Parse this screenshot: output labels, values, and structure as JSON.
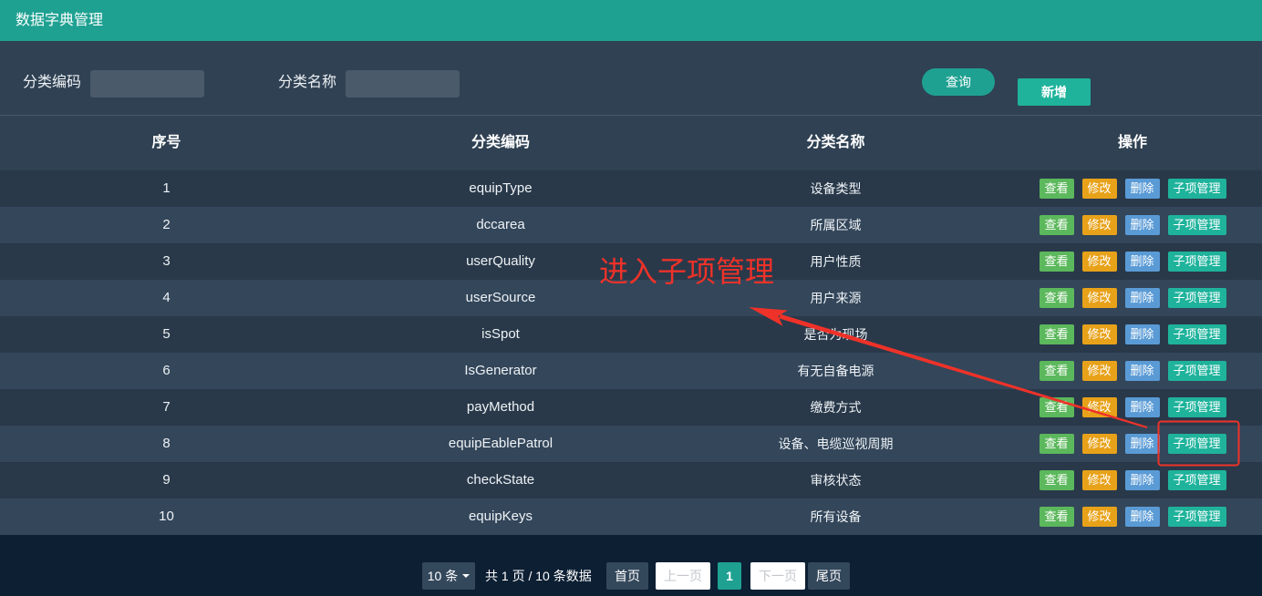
{
  "header": {
    "title": "数据字典管理"
  },
  "search": {
    "code_label": "分类编码",
    "code_value": "",
    "name_label": "分类名称",
    "name_value": "",
    "query_button": "查询",
    "add_button": "新增"
  },
  "table": {
    "columns": {
      "index": "序号",
      "code": "分类编码",
      "name": "分类名称",
      "actions": "操作"
    },
    "rows": [
      {
        "index": "1",
        "code": "equipType",
        "name": "设备类型"
      },
      {
        "index": "2",
        "code": "dccarea",
        "name": "所属区域"
      },
      {
        "index": "3",
        "code": "userQuality",
        "name": "用户性质"
      },
      {
        "index": "4",
        "code": "userSource",
        "name": "用户来源"
      },
      {
        "index": "5",
        "code": "isSpot",
        "name": "是否为现场"
      },
      {
        "index": "6",
        "code": "IsGenerator",
        "name": "有无自备电源"
      },
      {
        "index": "7",
        "code": "payMethod",
        "name": "缴费方式"
      },
      {
        "index": "8",
        "code": "equipEablePatrol",
        "name": "设备、电缆巡视周期"
      },
      {
        "index": "9",
        "code": "checkState",
        "name": "审核状态"
      },
      {
        "index": "10",
        "code": "equipKeys",
        "name": "所有设备"
      }
    ],
    "row_actions": {
      "view": "查看",
      "edit": "修改",
      "delete": "删除",
      "sub_items": "子项管理"
    }
  },
  "pagination": {
    "page_size": "10 条",
    "page_size_icon": "caret-down-icon",
    "summary": "共 1 页 / 10 条数据",
    "first": "首页",
    "prev": "上一页",
    "current_page": "1",
    "next": "下一页",
    "last": "尾页"
  },
  "annotation": {
    "label": "进入子项管理"
  },
  "colors": {
    "header": "#1fa192",
    "background": "#2f4153",
    "row_odd": "#29394a",
    "row_even": "#33465a",
    "footer": "#0d1f33",
    "view_button": "#5cb85c",
    "edit_button": "#e8a219",
    "delete_button": "#5a9bd6",
    "sub_items_button": "#1fb39c",
    "annotation": "#ee3229",
    "input": "#4b5a6a",
    "page_button": "#34485c"
  }
}
